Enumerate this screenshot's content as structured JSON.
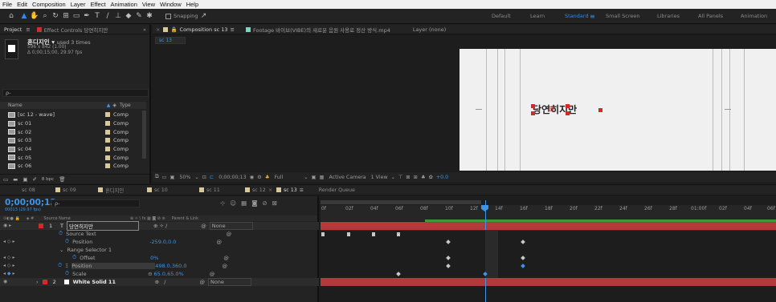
{
  "menu": [
    "File",
    "Edit",
    "Composition",
    "Layer",
    "Effect",
    "Animation",
    "View",
    "Window",
    "Help"
  ],
  "toolbar": {
    "snapping_label": "Snapping"
  },
  "workspaces": [
    "Default",
    "Learn",
    "Standard",
    "Small Screen",
    "Libraries",
    "All Panels",
    "Animation"
  ],
  "workspace_active": "Standard",
  "left_tabs": {
    "project": "Project",
    "effect_controls": "Effect Controls 당연히지만"
  },
  "project": {
    "item_name": "혼디지인",
    "used": "used 3 times",
    "dims": "596 x 842 (1.00)",
    "duration": "Δ 0;00;15;00, 29.97 fps",
    "search_placeholder": "ρ-",
    "col_name": "Name",
    "col_type": "Type",
    "items": [
      {
        "name": "[sc 12 - wave]",
        "type": "Comp"
      },
      {
        "name": "sc 01",
        "type": "Comp"
      },
      {
        "name": "sc 02",
        "type": "Comp"
      },
      {
        "name": "sc 03",
        "type": "Comp"
      },
      {
        "name": "sc 04",
        "type": "Comp"
      },
      {
        "name": "sc 05",
        "type": "Comp"
      },
      {
        "name": "sc 06",
        "type": "Comp"
      }
    ],
    "bpc": "8 bpc"
  },
  "viewer_tabs": {
    "composition": "Composition sc 13",
    "footage": "Footage 바이브(VIBE)의 새로운 음원 사용료 정산 방식.mp4",
    "layer": "Layer (none)"
  },
  "comp_crumb": "sc 13",
  "comp_text": "당연히지만",
  "viewer_bar": {
    "zoom": "50%",
    "timecode": "0;00;00;13",
    "resolution": "Full",
    "camera": "Active Camera",
    "view": "1 View",
    "offset": "+0.0"
  },
  "timeline_tabs": [
    "sc 08",
    "sc 09",
    "혼디지인",
    "sc 10",
    "sc 11",
    "sc 12",
    "sc 13",
    "Render Queue"
  ],
  "timeline_active": "sc 13",
  "timecode": "0;00;00;13",
  "timecode_sub": "00013 (29.97 fps)",
  "search_placeholder": "ρ-",
  "cols": {
    "source": "Source Name",
    "parent": "Parent & Link"
  },
  "layers": [
    {
      "num": "1",
      "name": "당연히지만",
      "parent": "None"
    },
    {
      "prop": "Source Text"
    },
    {
      "prop": "Position",
      "value": "-259.0,0.0"
    },
    {
      "prop": "Range Selector 1"
    },
    {
      "prop": "Offset",
      "value": "0%"
    },
    {
      "prop": "Position",
      "value": "498.0,360.0"
    },
    {
      "prop": "Scale",
      "value": "65.0,65.0%"
    },
    {
      "num": "2",
      "name": "White Solid 11",
      "parent": "None"
    }
  ],
  "ruler": [
    "0f",
    "02f",
    "04f",
    "06f",
    "08f",
    "10f",
    "12f",
    "14f",
    "16f",
    "18f",
    "20f",
    "22f",
    "24f",
    "26f",
    "28f",
    "01:00f",
    "02f",
    "04f",
    "06f"
  ]
}
